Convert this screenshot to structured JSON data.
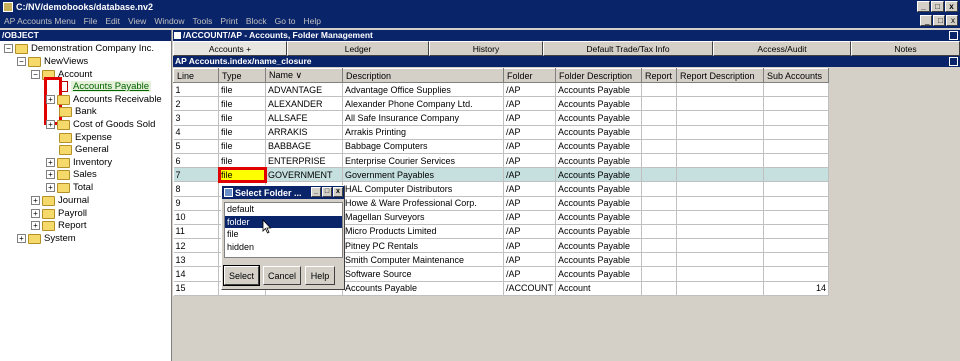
{
  "window": {
    "title": "C:/NV/demobooks/database.nv2",
    "controls": [
      "_",
      "□",
      "x"
    ]
  },
  "menubar": {
    "items": [
      "AP Accounts Menu",
      "File",
      "Edit",
      "View",
      "Window",
      "Tools",
      "Print",
      "Block",
      "Go to",
      "Help"
    ]
  },
  "tree": {
    "header": "/OBJECT",
    "nodes": [
      {
        "label": "Demonstration Company Inc.",
        "pm": "−"
      },
      {
        "label": "NewViews",
        "pm": "−"
      },
      {
        "label": "Account",
        "pm": "−"
      },
      {
        "label": "Accounts Payable",
        "pm": ""
      },
      {
        "label": "Accounts Receivable",
        "pm": "+"
      },
      {
        "label": "Bank",
        "pm": ""
      },
      {
        "label": "Cost of Goods Sold",
        "pm": "+"
      },
      {
        "label": "Expense",
        "pm": ""
      },
      {
        "label": "General",
        "pm": ""
      },
      {
        "label": "Inventory",
        "pm": "+"
      },
      {
        "label": "Sales",
        "pm": "+"
      },
      {
        "label": "Total",
        "pm": "+"
      },
      {
        "label": "Journal",
        "pm": "+"
      },
      {
        "label": "Payroll",
        "pm": "+"
      },
      {
        "label": "Report",
        "pm": "+"
      },
      {
        "label": "System",
        "pm": "+"
      }
    ]
  },
  "main": {
    "title": "/ACCOUNT/AP - Accounts, Folder Management",
    "tabs": [
      "Accounts      +",
      "Ledger",
      "History",
      "Default Trade/Tax Info",
      "Access/Audit",
      "Notes"
    ],
    "subtitle": "AP Accounts.index/name_closure",
    "columns": [
      "Line",
      "Type",
      "Name ∨",
      "Description",
      "Folder",
      "Folder Description",
      "Report",
      "Report Description",
      "Sub Accounts"
    ],
    "rows": [
      [
        "1",
        "file",
        "ADVANTAGE",
        "Advantage Office Supplies",
        "/AP",
        "Accounts Payable",
        "",
        "",
        ""
      ],
      [
        "2",
        "file",
        "ALEXANDER",
        "Alexander Phone Company Ltd.",
        "/AP",
        "Accounts Payable",
        "",
        "",
        ""
      ],
      [
        "3",
        "file",
        "ALLSAFE",
        "All Safe Insurance Company",
        "/AP",
        "Accounts Payable",
        "",
        "",
        ""
      ],
      [
        "4",
        "file",
        "ARRAKIS",
        "Arrakis Printing",
        "/AP",
        "Accounts Payable",
        "",
        "",
        ""
      ],
      [
        "5",
        "file",
        "BABBAGE",
        "Babbage Computers",
        "/AP",
        "Accounts Payable",
        "",
        "",
        ""
      ],
      [
        "6",
        "file",
        "ENTERPRISE",
        "Enterprise Courier Services",
        "/AP",
        "Accounts Payable",
        "",
        "",
        ""
      ],
      [
        "7",
        "file",
        "GOVERNMENT",
        "Government Payables",
        "/AP",
        "Accounts Payable",
        "",
        "",
        ""
      ],
      [
        "8",
        "",
        "",
        "HAL Computer Distributors",
        "/AP",
        "Accounts Payable",
        "",
        "",
        ""
      ],
      [
        "9",
        "",
        "",
        "Howe & Ware Professional Corp.",
        "/AP",
        "Accounts Payable",
        "",
        "",
        ""
      ],
      [
        "10",
        "",
        "",
        "Magellan Surveyors",
        "/AP",
        "Accounts Payable",
        "",
        "",
        ""
      ],
      [
        "11",
        "",
        "",
        "Micro Products Limited",
        "/AP",
        "Accounts Payable",
        "",
        "",
        ""
      ],
      [
        "12",
        "",
        "",
        "Pitney PC Rentals",
        "/AP",
        "Accounts Payable",
        "",
        "",
        ""
      ],
      [
        "13",
        "",
        "",
        "Smith Computer Maintenance",
        "/AP",
        "Accounts Payable",
        "",
        "",
        ""
      ],
      [
        "14",
        "",
        "",
        "Software Source",
        "/AP",
        "Accounts Payable",
        "",
        "",
        ""
      ],
      [
        "15",
        "",
        "",
        "Accounts Payable",
        "/ACCOUNT",
        "Account",
        "",
        "",
        "14"
      ]
    ]
  },
  "popup": {
    "title": "Select Folder ...",
    "options": [
      "default",
      "folder",
      "file",
      "hidden"
    ],
    "selected": "folder",
    "buttons": {
      "select": "Select",
      "cancel": "Cancel",
      "help": "Help"
    }
  },
  "colors": {
    "titlebar": "#0a246a",
    "highlight_row": "#c6e0e0",
    "editing_cell": "#ffff00",
    "annotation": "#e00000"
  }
}
